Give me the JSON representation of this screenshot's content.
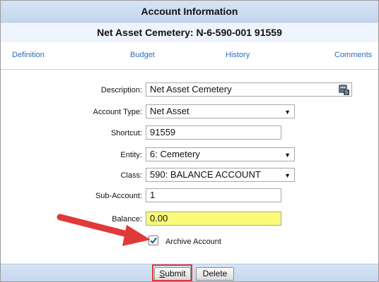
{
  "header": {
    "title": "Account Information",
    "subtitle": "Net Asset Cemetery: N-6-590-001 91559"
  },
  "tabs": [
    "Definition",
    "Budget",
    "History",
    "Comments"
  ],
  "form": {
    "description": {
      "label": "Description:",
      "value": "Net Asset Cemetery"
    },
    "account_type": {
      "label": "Account Type:",
      "value": "Net Asset"
    },
    "shortcut": {
      "label": "Shortcut:",
      "value": "91559"
    },
    "entity": {
      "label": "Entity:",
      "value": "6: Cemetery"
    },
    "class": {
      "label": "Class:",
      "value": "590: BALANCE ACCOUNT"
    },
    "sub_account": {
      "label": "Sub-Account:",
      "value": "1"
    },
    "balance": {
      "label": "Balance:",
      "value": "0.00"
    },
    "archive": {
      "label": "Archive Account",
      "checked": true
    }
  },
  "footer": {
    "submit": "Submit",
    "delete": "Delete"
  },
  "colors": {
    "balance_bg": "#fafa78",
    "annotation": "#e0393a",
    "link": "#2b6fb8"
  }
}
